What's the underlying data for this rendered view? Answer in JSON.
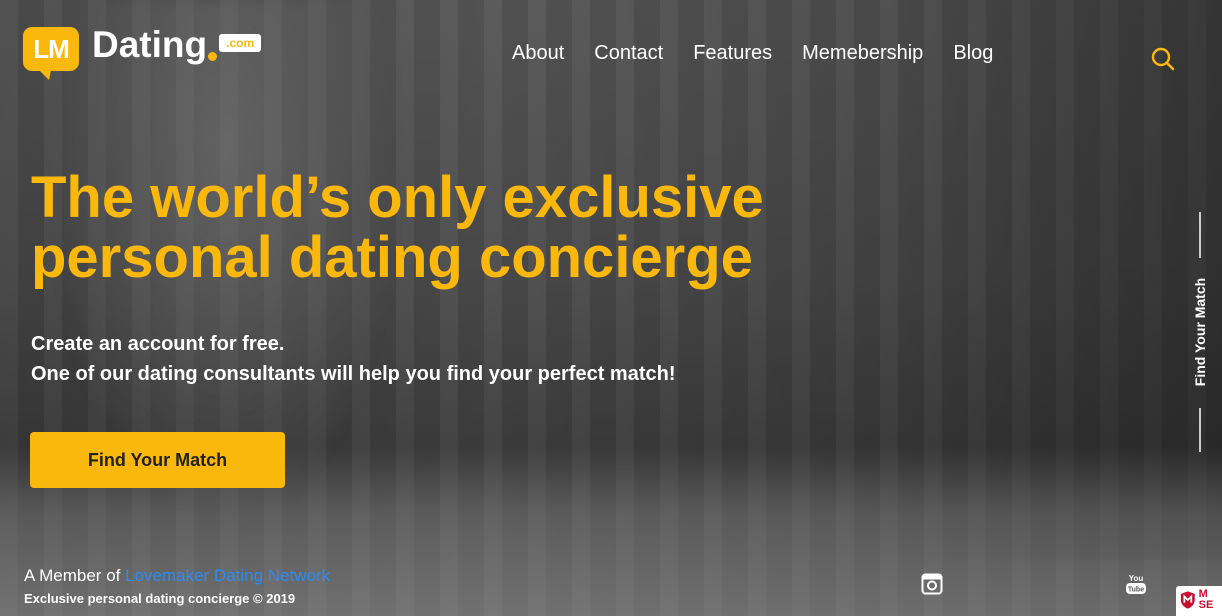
{
  "brand": {
    "monogram": "LM",
    "name": "Dating",
    "tld": ".com"
  },
  "nav": {
    "items": [
      {
        "label": "About"
      },
      {
        "label": "Contact"
      },
      {
        "label": "Features"
      },
      {
        "label": "Memebership"
      },
      {
        "label": "Blog"
      }
    ],
    "search_icon": "search-icon"
  },
  "hero": {
    "headline": "The world’s only exclusive personal dating concierge",
    "subtext_line1": "Create an account for free.",
    "subtext_line2": "One of our dating consultants will help you find your perfect match!",
    "cta_label": "Find Your Match"
  },
  "side_rail": {
    "label": "Find Your Match"
  },
  "footer": {
    "member_prefix": "A Member of",
    "member_link": "Lovemaker Dating Network",
    "copyright": "Exclusive personal dating concierge © 2019"
  },
  "social": {
    "instagram_icon": "instagram-icon",
    "youtube_icon": "youtube-icon",
    "youtube_text": "You Tube"
  },
  "security_badge": {
    "text": "M SE"
  },
  "colors": {
    "accent": "#fbb80c",
    "link": "#2a8cf5",
    "text": "#ffffff"
  }
}
